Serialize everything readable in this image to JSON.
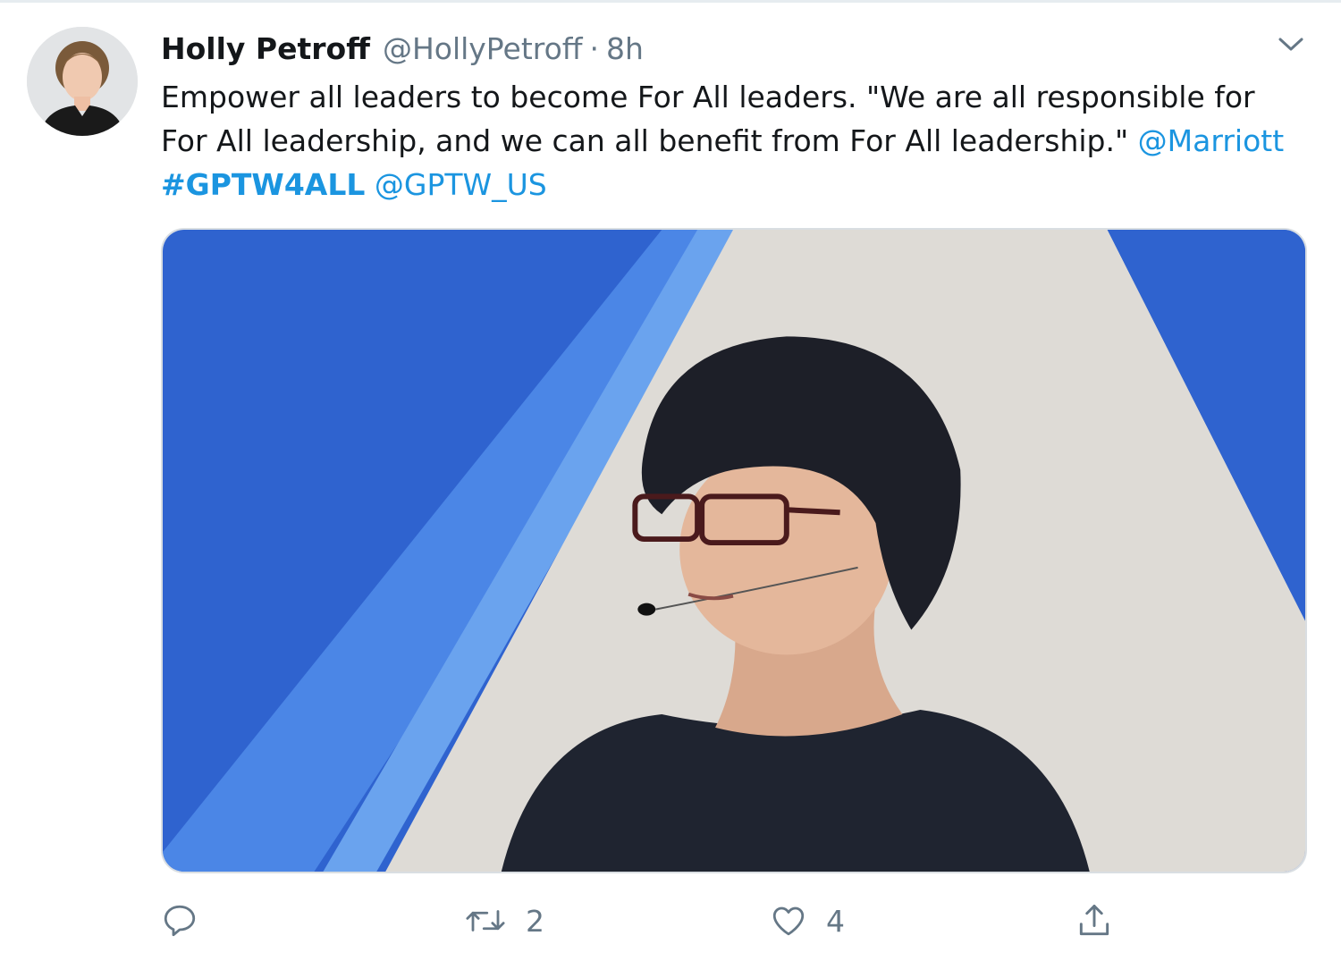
{
  "tweet": {
    "author_name": "Holly Petroff",
    "author_handle": "@HollyPetroff",
    "separator": "·",
    "timestamp": "8h",
    "text": {
      "line1": "Empower all leaders to become For All leaders. \"We are all responsible for",
      "line2_text": "For All leadership, and we can all benefit from For All leadership.\" ",
      "mention1": "@Marriott",
      "hashtag": "#GPTW4ALL",
      "mention2": "@GPTW_US"
    },
    "media": {
      "kind": "photo",
      "description_icon": "photo-of-speaker-on-stage"
    },
    "actions": {
      "reply": {
        "icon": "reply-icon",
        "count": ""
      },
      "retweet": {
        "icon": "retweet-icon",
        "count": "2"
      },
      "like": {
        "icon": "heart-icon",
        "count": "4"
      },
      "share": {
        "icon": "share-icon",
        "count": ""
      }
    }
  },
  "colors": {
    "link": "#1b95e0",
    "secondary_text": "#657786",
    "primary_text": "#14171a"
  }
}
